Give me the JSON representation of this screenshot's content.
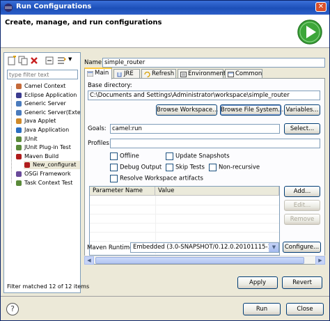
{
  "window": {
    "title": "Run Configurations",
    "header": "Create, manage, and run configurations"
  },
  "left": {
    "filter_placeholder": "type filter text",
    "tree": [
      {
        "label": "Camel Context",
        "icon": "camel-context-icon",
        "color": "#c46a3a"
      },
      {
        "label": "Eclipse Application",
        "icon": "eclipse-app-icon",
        "color": "#3b3b8f"
      },
      {
        "label": "Generic Server",
        "icon": "server-icon",
        "color": "#4a7bbd"
      },
      {
        "label": "Generic Server(Exte",
        "icon": "server-icon",
        "color": "#4a7bbd"
      },
      {
        "label": "Java Applet",
        "icon": "java-applet-icon",
        "color": "#d08a2a"
      },
      {
        "label": "Java Application",
        "icon": "java-app-icon",
        "color": "#2b6fc2"
      },
      {
        "label": "JUnit",
        "icon": "junit-icon",
        "color": "#5a8a3a"
      },
      {
        "label": "JUnit Plug-in Test",
        "icon": "junit-icon",
        "color": "#5a8a3a"
      },
      {
        "label": "Maven Build",
        "icon": "maven-icon",
        "color": "#b01c1c"
      },
      {
        "label": "New_configurat",
        "icon": "maven-config-icon",
        "color": "#b01c1c"
      },
      {
        "label": "OSGi Framework",
        "icon": "osgi-icon",
        "color": "#6a4a9a"
      },
      {
        "label": "Task Context Test",
        "icon": "task-icon",
        "color": "#5a8a3a"
      }
    ],
    "status": "Filter matched 12 of 12 items"
  },
  "config": {
    "name_label": "Name:",
    "name_value": "simple_router",
    "tabs": [
      {
        "label": "Main"
      },
      {
        "label": "JRE"
      },
      {
        "label": "Refresh"
      },
      {
        "label": "Environment"
      },
      {
        "label": "Common"
      }
    ],
    "base_dir_label": "Base directory:",
    "base_dir_value": "C:\\Documents and Settings\\Administrator\\workspace\\simple_router",
    "browse_workspace": "Browse Workspace...",
    "browse_fs": "Browse File System...",
    "variables": "Variables...",
    "goals_label": "Goals:",
    "goals_value": "camel:run",
    "select": "Select...",
    "profiles_label": "Profiles:",
    "profiles_value": "",
    "checkboxes": {
      "offline": "Offline",
      "update_snapshots": "Update Snapshots",
      "debug_output": "Debug Output",
      "skip_tests": "Skip Tests",
      "non_recursive": "Non-recursive",
      "resolve_workspace": "Resolve Workspace artifacts"
    },
    "param_headers": [
      "Parameter Name",
      "Value"
    ],
    "add": "Add...",
    "edit": "Edit...",
    "remove": "Remove",
    "runtime_label": "Maven Runtime:",
    "runtime_value": "Embedded (3.0-SNAPSHOT/0.12.0.20101115-1102)",
    "configure": "Configure...",
    "apply": "Apply",
    "revert": "Revert"
  },
  "bottom": {
    "run": "Run",
    "close": "Close"
  },
  "colors": {
    "titlebar": "#1c4fb8",
    "tab_highlight": "#ffc83c",
    "run_badge": "#3da63a"
  }
}
